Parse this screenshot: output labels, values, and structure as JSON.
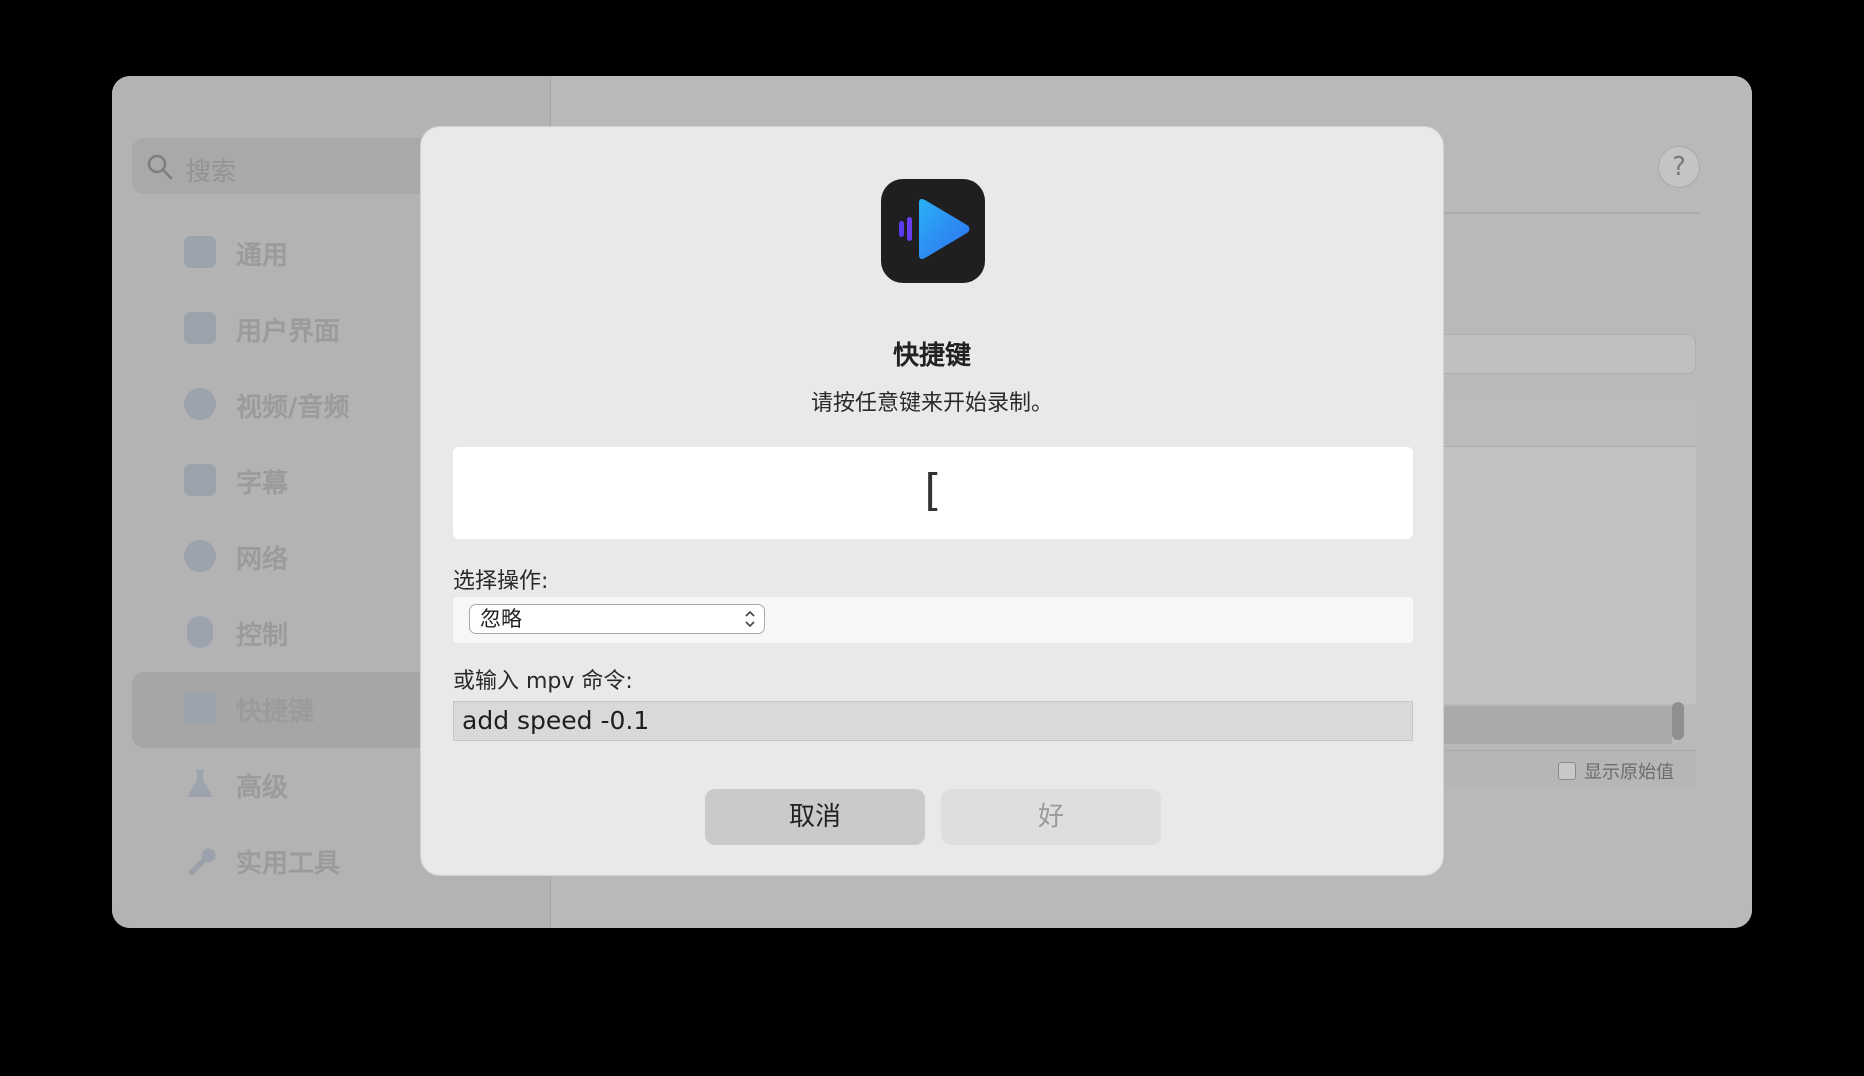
{
  "sidebar": {
    "search_placeholder": "搜索",
    "items": [
      {
        "label": "通用",
        "icon": "general-settings-icon"
      },
      {
        "label": "用户界面",
        "icon": "window-icon"
      },
      {
        "label": "视频/音频",
        "icon": "play-circle-icon"
      },
      {
        "label": "字幕",
        "icon": "subtitles-bubble-icon"
      },
      {
        "label": "网络",
        "icon": "globe-icon"
      },
      {
        "label": "控制",
        "icon": "mouse-icon"
      },
      {
        "label": "快捷键",
        "icon": "keyboard-icon",
        "active": true
      },
      {
        "label": "高级",
        "icon": "flask-icon"
      },
      {
        "label": "实用工具",
        "icon": "wrench-icon"
      }
    ]
  },
  "main": {
    "help_label": "?",
    "show_raw_label": "显示原始值"
  },
  "dialog": {
    "title": "快捷键",
    "subtitle": "请按任意键来开始录制。",
    "recorded_key": "[",
    "select_label": "选择操作:",
    "select_value": "忽略",
    "command_label": "或输入 mpv 命令:",
    "command_value": "add speed -0.1",
    "cancel_label": "取消",
    "ok_label": "好"
  },
  "colors": {
    "accent_green": "#2fa83a",
    "accent_yellow": "#e8a527",
    "icon_blue": "#2f8cf0",
    "icon_purple": "#6a3cf0"
  }
}
